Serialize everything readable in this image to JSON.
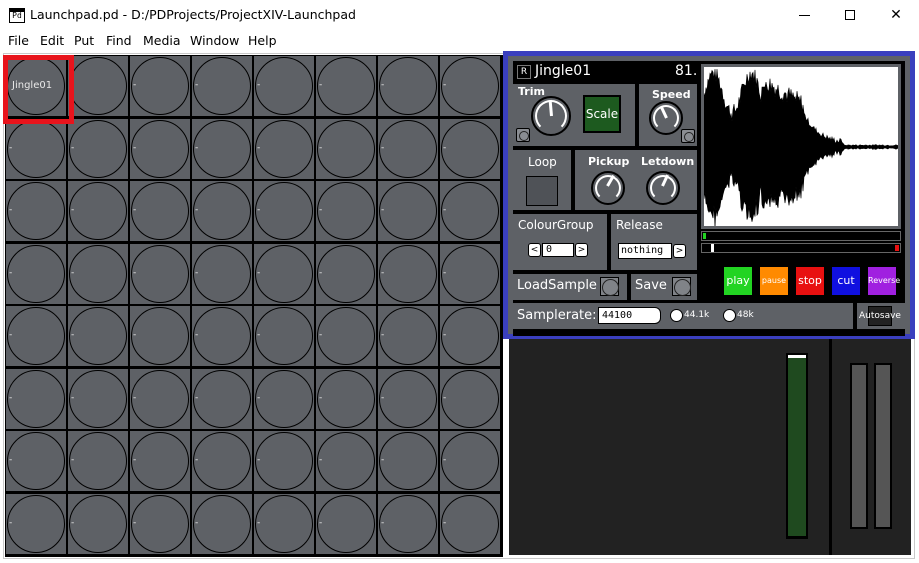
{
  "window": {
    "title": "Launchpad.pd  -  D:/PDProjects/ProjectXIV-Launchpad",
    "icon_text": "Pd",
    "buttons": {
      "minimize": "",
      "maximize": "",
      "close": "✕"
    }
  },
  "menu": [
    "File",
    "Edit",
    "Put",
    "Find",
    "Media",
    "Window",
    "Help"
  ],
  "grid": {
    "rows": 8,
    "cols": 8,
    "labels": [
      [
        "Jingle01",
        "-",
        "-",
        "-",
        "-",
        "-",
        "-",
        "-"
      ],
      [
        "-",
        "-",
        "-",
        "-",
        "-",
        "-",
        "-",
        "-"
      ],
      [
        "-",
        "-",
        "-",
        "-",
        "-",
        "-",
        "-",
        "-"
      ],
      [
        "-",
        "-",
        "-",
        "-",
        "-",
        "-",
        "-",
        "-"
      ],
      [
        "-",
        "-",
        "-",
        "-",
        "-",
        "-",
        "-",
        "-"
      ],
      [
        "-",
        "-",
        "-",
        "-",
        "-",
        "-",
        "-",
        "-"
      ],
      [
        "-",
        "-",
        "-",
        "-",
        "-",
        "-",
        "-",
        "-"
      ],
      [
        "-",
        "-",
        "-",
        "-",
        "-",
        "-",
        "-",
        "-"
      ]
    ],
    "selected": "Jingle01"
  },
  "panel": {
    "r_button": "R",
    "name": "Jingle01",
    "number": "81.",
    "trim_label": "Trim",
    "scale_label": "Scale",
    "speed_label": "Speed",
    "loop_label": "Loop",
    "pickup_label": "Pickup",
    "letdown_label": "Letdown",
    "colourgroup_label": "ColourGroup",
    "colourgroup_value": "0",
    "release_label": "Release",
    "release_value": "nothing",
    "loadsample_label": "LoadSample",
    "save_label": "Save",
    "samplerate_label": "Samplerate:",
    "samplerate_value": "44100",
    "rate_44": "44.1k",
    "rate_48": "48k",
    "autosave_label": "Autosave",
    "prev_arrow": "<",
    "next_arrow": ">",
    "transport": [
      {
        "label": "play",
        "color": "#22d422"
      },
      {
        "label": "pause",
        "color": "#ff8a00"
      },
      {
        "label": "stop",
        "color": "#e81010"
      },
      {
        "label": "cut",
        "color": "#1010e0"
      },
      {
        "label": "Reverse",
        "color": "#a020e0"
      }
    ],
    "scale_color": "#1d5a1f",
    "border_color": "#3a3fbe"
  }
}
